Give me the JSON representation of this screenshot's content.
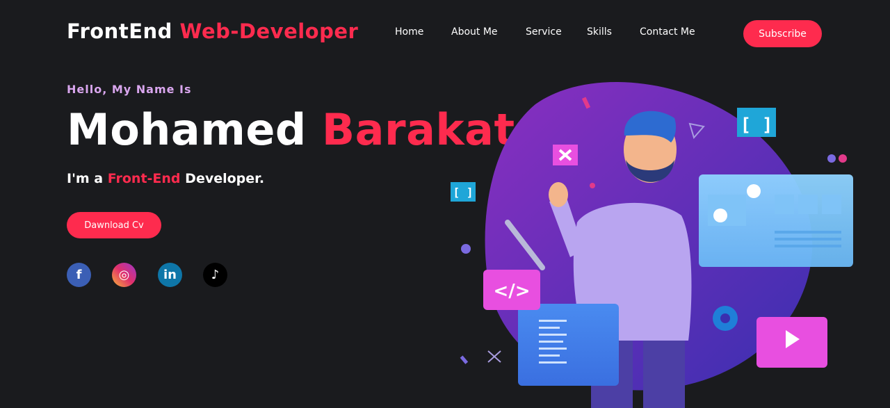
{
  "header": {
    "logo_main": "FrontEnd",
    "logo_accent": "Web-Developer",
    "nav": [
      "Home",
      "About Me",
      "Service",
      "Skills",
      "Contact Me"
    ],
    "subscribe_label": "Subscribe"
  },
  "hero": {
    "greeting": "Hello, My Name Is",
    "first_name": "Mohamed",
    "last_name": "Barakat",
    "role_prefix": "I'm a",
    "role_accent": "Front-End",
    "role_suffix": "Developer.",
    "cv_label": "Dawnload Cv"
  },
  "social": {
    "facebook": "f",
    "instagram": "◎",
    "linkedin": "in",
    "tiktok": "♪"
  },
  "illustration": {
    "code_tag": "</>",
    "brackets": "[ ]",
    "small_brackets": "[ ]"
  },
  "colors": {
    "background": "#1a1b1e",
    "accent": "#fe2b4e",
    "greeting": "#d9a6ee"
  }
}
